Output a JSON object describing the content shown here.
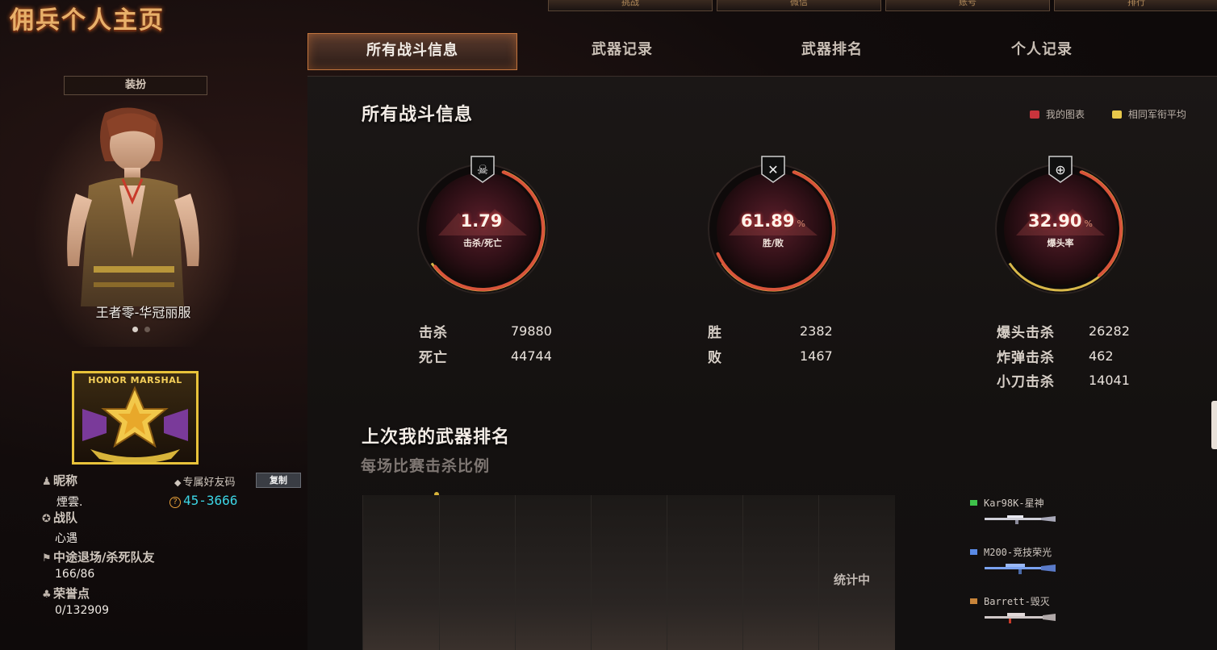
{
  "header": {
    "title": "佣兵个人主页",
    "nav": [
      "挑战",
      "微信",
      "账号",
      "排行"
    ]
  },
  "tabs": [
    {
      "label": "所有战斗信息",
      "active": true
    },
    {
      "label": "武器记录",
      "active": false
    },
    {
      "label": "武器排名",
      "active": false
    },
    {
      "label": "个人记录",
      "active": false
    }
  ],
  "sidebar": {
    "costume_button": "装扮",
    "costume_name": "王者零-华冠丽服",
    "carousel_total": 2,
    "carousel_current": 1,
    "rank_badge_text": "HONOR MARSHAL",
    "nickname_label": "昵称",
    "nickname": "煙雲.",
    "friend_code_label": "专属好友码",
    "copy_button": "复制",
    "friend_code": "45-3666",
    "team_label": "战队",
    "team": "心遇",
    "quit_label": "中途退场/杀死队友",
    "quit_value": "166/86",
    "honor_label": "荣誉点",
    "honor_value": "0/132909"
  },
  "main": {
    "section_title": "所有战斗信息",
    "legend": [
      {
        "label": "我的图表",
        "color": "#c8343c"
      },
      {
        "label": "相同军衔平均",
        "color": "#e8c84a"
      }
    ],
    "gauges": [
      {
        "value": "1.79",
        "pct": "",
        "label": "击杀/死亡",
        "icon": "skull-icon",
        "fill": 0.58
      },
      {
        "value": "61.89",
        "pct": "%",
        "label": "胜/败",
        "icon": "crossed-rifles-icon",
        "fill": 0.6189
      },
      {
        "value": "32.90",
        "pct": "%",
        "label": "爆头率",
        "icon": "crosshair-icon",
        "fill": 0.329
      }
    ],
    "stats": {
      "kd": [
        {
          "name": "击杀",
          "value": "79880"
        },
        {
          "name": "死亡",
          "value": "44744"
        }
      ],
      "wl": [
        {
          "name": "胜",
          "value": "2382"
        },
        {
          "name": "败",
          "value": "1467"
        }
      ],
      "hs": [
        {
          "name": "爆头击杀",
          "value": "26282"
        },
        {
          "name": "炸弹击杀",
          "value": "462"
        },
        {
          "name": "小刀击杀",
          "value": "14041"
        }
      ]
    },
    "weapon_section_title": "上次我的武器排名",
    "weapon_section_subtitle": "每场比赛击杀比例",
    "weapon_status": "统计中",
    "weapons": [
      {
        "name": "Kar98K-星神",
        "color": "#3ec24a"
      },
      {
        "name": "M200-竞技荣光",
        "color": "#5a8ae6"
      },
      {
        "name": "Barrett-毁灭",
        "color": "#c8843a"
      }
    ]
  }
}
